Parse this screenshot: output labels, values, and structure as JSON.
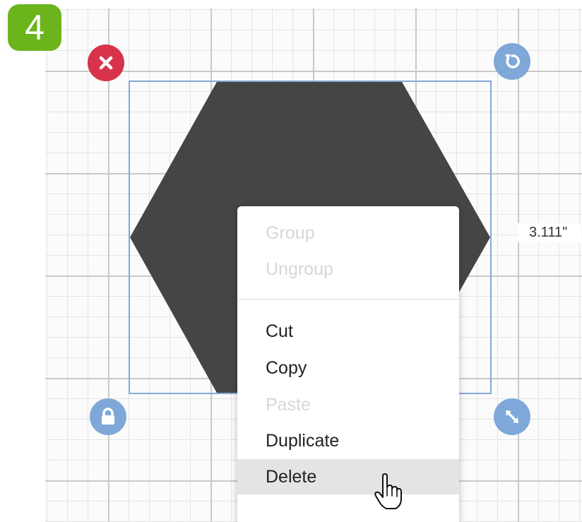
{
  "step": {
    "number": "4",
    "color": "#6cb41c"
  },
  "canvas": {
    "grid_color": "#c9c9c9"
  },
  "shape": {
    "name": "hexagon",
    "fill": "#454545"
  },
  "selection": {
    "border_color": "#86a8d4",
    "dimension_label": "3.111\"",
    "handles": {
      "close": {
        "icon": "close-icon",
        "color": "#d8334a"
      },
      "rotate": {
        "icon": "rotate-icon",
        "color": "#7fa8d9"
      },
      "lock": {
        "icon": "lock-icon",
        "color": "#7fa8d9"
      },
      "resize": {
        "icon": "resize-icon",
        "color": "#7fa8d9"
      }
    }
  },
  "context_menu": {
    "items": [
      {
        "label": "Group",
        "enabled": false
      },
      {
        "label": "Ungroup",
        "enabled": false
      },
      {
        "label": "Cut",
        "enabled": true
      },
      {
        "label": "Copy",
        "enabled": true
      },
      {
        "label": "Paste",
        "enabled": false
      },
      {
        "label": "Duplicate",
        "enabled": true
      },
      {
        "label": "Delete",
        "enabled": true,
        "hovered": true
      }
    ]
  },
  "cursor": {
    "icon": "hand-pointer-icon"
  }
}
